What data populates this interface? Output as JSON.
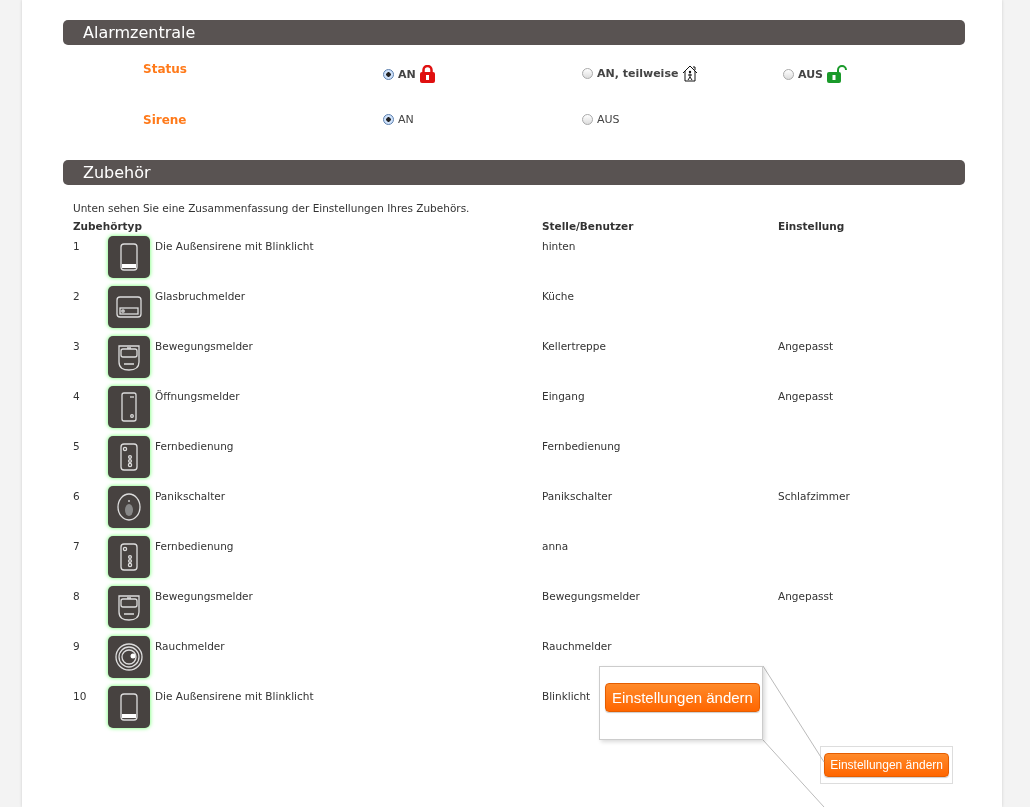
{
  "alarm_panel": {
    "title": "Alarmzentrale",
    "settings": [
      {
        "label": "Status",
        "emphasis": true,
        "options": [
          {
            "label": "AN",
            "selected": true,
            "kind": "full"
          },
          {
            "label": "AN, teilweise",
            "selected": false,
            "kind": "partial"
          },
          {
            "label": "AUS",
            "selected": false,
            "kind": "off"
          }
        ]
      },
      {
        "label": "Sirene",
        "emphasis": false,
        "options": [
          {
            "label": "AN",
            "selected": true
          },
          {
            "label": "AUS",
            "selected": false
          }
        ]
      }
    ]
  },
  "accessories": {
    "title": "Zubehör",
    "intro": "Unten sehen Sie eine Zusammenfassung der Einstellungen Ihres Zubehörs.",
    "columns": [
      "Zubehörtyp",
      "Stelle/Benutzer",
      "Einstellung"
    ],
    "rows": [
      {
        "number": "1",
        "kind": "siren",
        "type": "Die Außensirene mit Blinklicht",
        "location": "hinten"
      },
      {
        "number": "2",
        "kind": "glass",
        "type": "Glasbruchmelder",
        "location": "Küche"
      },
      {
        "number": "3",
        "kind": "motion",
        "type": "Bewegungsmelder",
        "location": "Kellertreppe",
        "setting": "Angepasst"
      },
      {
        "number": "4",
        "kind": "contact",
        "type": "Öffnungsmelder",
        "location": "Eingang",
        "setting": "Angepasst"
      },
      {
        "number": "5",
        "kind": "remote",
        "type": "Fernbedienung",
        "location": "Fernbedienung"
      },
      {
        "number": "6",
        "kind": "panic",
        "type": "Panikschalter",
        "location": "Panikschalter",
        "setting": "Schlafzimmer"
      },
      {
        "number": "7",
        "kind": "remote",
        "type": "Fernbedienung",
        "location": "anna"
      },
      {
        "number": "8",
        "kind": "motion",
        "type": "Bewegungsmelder",
        "location": "Bewegungsmelder",
        "setting": "Angepasst"
      },
      {
        "number": "9",
        "kind": "smoke",
        "type": "Rauchmelder",
        "location": "Rauchmelder"
      },
      {
        "number": "10",
        "kind": "siren",
        "type": "Die Außensirene mit Blinklicht",
        "location": "Blinklicht"
      }
    ]
  },
  "action_button": {
    "label": "Einstellungen ändern"
  },
  "zoom_callout": {
    "label": "Einstellungen ändern"
  }
}
